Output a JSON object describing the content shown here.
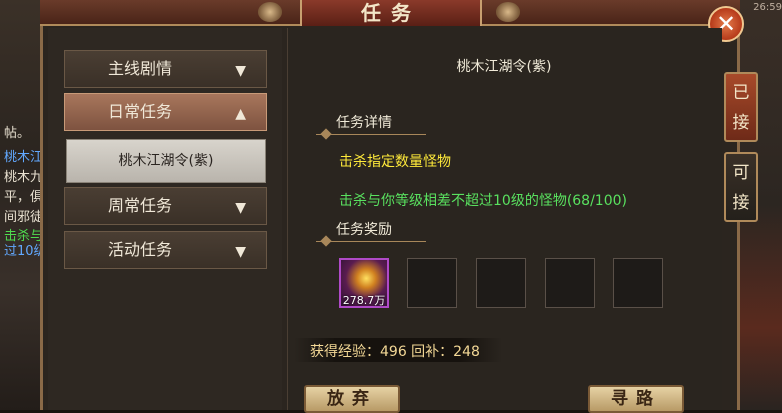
{
  "window": {
    "title": "任务"
  },
  "background": {
    "coord_text": "26:59",
    "snippets": [
      {
        "text": "帖。",
        "color": "white"
      },
      {
        "text": "桃木江",
        "color": "blue"
      },
      {
        "text": "桃木九",
        "color": "white"
      },
      {
        "text": "平，俱",
        "color": "white"
      },
      {
        "text": "间邪徒",
        "color": "white"
      },
      {
        "text": "击杀与",
        "color": "green"
      },
      {
        "text": "过10级",
        "color": "blue"
      }
    ]
  },
  "sidebar": {
    "categories": [
      {
        "label": "主线剧情",
        "expanded": false
      },
      {
        "label": "日常任务",
        "expanded": true
      },
      {
        "label": "周常任务",
        "expanded": false
      },
      {
        "label": "活动任务",
        "expanded": false
      }
    ],
    "selected_quest": "桃木江湖令(紫)"
  },
  "quest": {
    "name": "桃木江湖令(紫)",
    "details_header": "任务详情",
    "objective": "击杀指定数量怪物",
    "progress_text": "击杀与你等级相差不超过10级的怪物(68/100)",
    "rewards_header": "任务奖励",
    "reward_item": {
      "count": "278.7万",
      "rarity_color": "#b04ac8"
    },
    "empty_slots": 4,
    "exp_text": "获得经验：496 回补：248"
  },
  "buttons": {
    "abandon": "放弃",
    "pathfind": "寻路",
    "close": "✕"
  },
  "side_tabs": [
    {
      "line1": "已",
      "line2": "接",
      "active": true
    },
    {
      "line1": "可",
      "line2": "接",
      "active": false
    }
  ],
  "arrows": {
    "down": "▼",
    "up": "▲"
  }
}
